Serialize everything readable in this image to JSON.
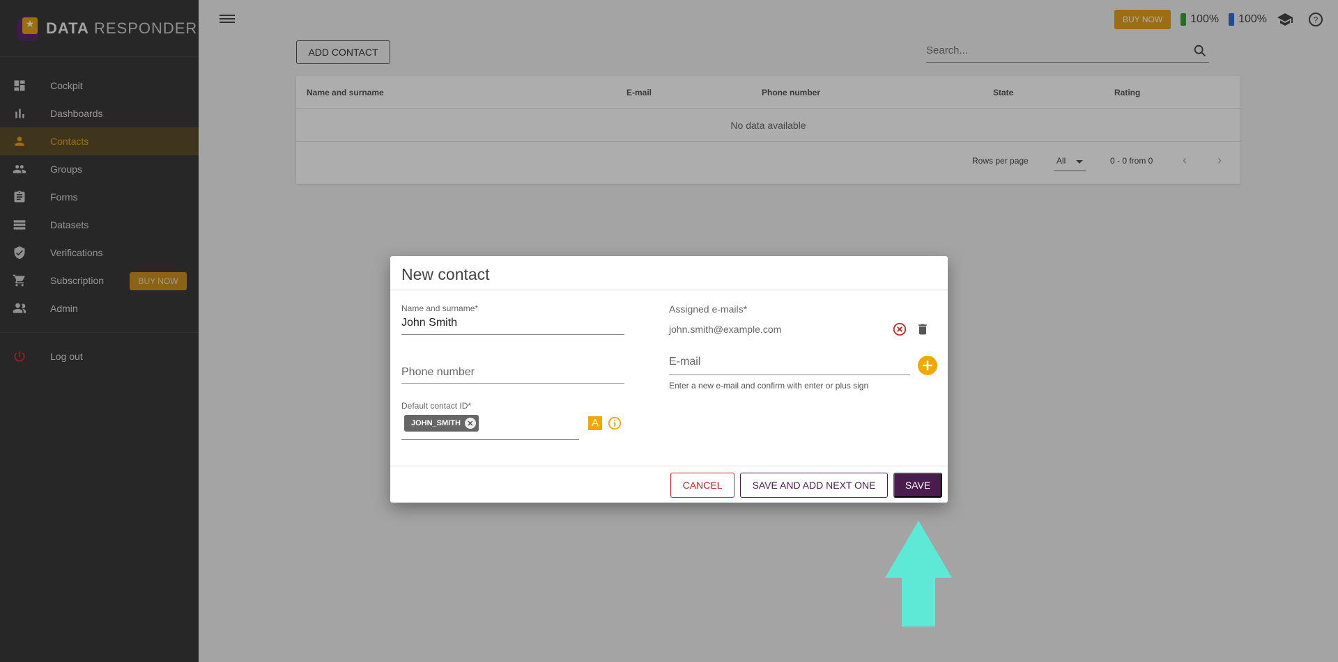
{
  "app": {
    "logo_bold": "DATA",
    "logo_light": " RESPONDER"
  },
  "sidebar": {
    "items": [
      {
        "label": "Cockpit",
        "icon": "dashboard-icon"
      },
      {
        "label": "Dashboards",
        "icon": "bar-chart-icon"
      },
      {
        "label": "Contacts",
        "icon": "person-icon",
        "active": true
      },
      {
        "label": "Groups",
        "icon": "people-icon"
      },
      {
        "label": "Forms",
        "icon": "clipboard-icon"
      },
      {
        "label": "Datasets",
        "icon": "list-icon"
      },
      {
        "label": "Verifications",
        "icon": "shield-check-icon"
      },
      {
        "label": "Subscription",
        "icon": "cart-icon",
        "badge": "BUY NOW"
      },
      {
        "label": "Admin",
        "icon": "admin-people-icon"
      }
    ],
    "logout": "Log out"
  },
  "topbar": {
    "buy_now": "BUY NOW",
    "battery_green": "100%",
    "battery_blue": "100%"
  },
  "toolbar": {
    "add_contact": "ADD CONTACT",
    "search_placeholder": "Search..."
  },
  "table": {
    "columns": [
      "Name and surname",
      "E-mail",
      "Phone number",
      "State",
      "Rating"
    ],
    "empty_text": "No data available",
    "rows_per_page_label": "Rows per page",
    "rows_per_page_value": "All",
    "range": "0 - 0 from 0"
  },
  "dialog": {
    "title": "New contact",
    "name_label": "Name and surname*",
    "name_value": "John Smith",
    "phone_placeholder": "Phone number",
    "contact_id_label": "Default contact ID*",
    "contact_id_chip": "JOHN_SMITH",
    "a_icon_letter": "A",
    "emails_label": "Assigned e-mails*",
    "assigned_email": "john.smith@example.com",
    "email_placeholder": "E-mail",
    "email_hint": "Enter a new e-mail and confirm with enter or plus sign",
    "cancel": "CANCEL",
    "save_next": "SAVE AND ADD NEXT ONE",
    "save": "SAVE"
  },
  "colors": {
    "accent": "#e8a21a",
    "primary": "#4a1d4e",
    "danger": "#c62828",
    "arrow": "#5ee8d6",
    "sidebar_bg": "#3a3a3a"
  }
}
